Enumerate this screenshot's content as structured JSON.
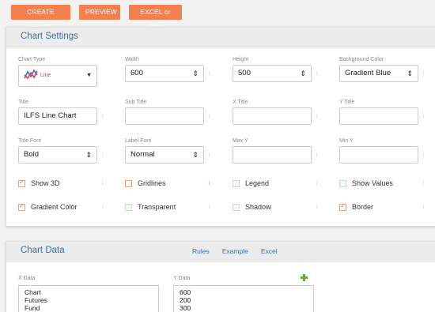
{
  "toolbar": {
    "create_chart": "CREATE CHART",
    "preview": "PREVIEW",
    "excel_csv": "EXCEL or CSV"
  },
  "settings": {
    "title": "Chart Settings",
    "chart_type": {
      "label": "Chart Type",
      "value": "Line"
    },
    "width": {
      "label": "Width",
      "value": "600"
    },
    "height": {
      "label": "Height",
      "value": "500"
    },
    "background_color": {
      "label": "Background Color",
      "value": "Gradient Blue"
    },
    "chart_title": {
      "label": "Title",
      "value": "ILFS Line Chart"
    },
    "sub_title": {
      "label": "Sub Title",
      "value": ""
    },
    "x_title": {
      "label": "X Title",
      "value": ""
    },
    "y_title": {
      "label": "Y Title",
      "value": ""
    },
    "title_font": {
      "label": "Title Font",
      "value": "Bold"
    },
    "label_font": {
      "label": "Label Font",
      "value": "Normal"
    },
    "max_y": {
      "label": "Max Y",
      "value": ""
    },
    "min_y": {
      "label": "Min Y",
      "value": ""
    },
    "checkboxes": {
      "show_3d": {
        "label": "Show 3D",
        "checked": true
      },
      "gridlines": {
        "label": "Gridlines",
        "checked": false
      },
      "legend": {
        "label": "Legend",
        "checked": false
      },
      "show_values": {
        "label": "Show Values",
        "checked": false
      },
      "gradient_color": {
        "label": "Gradient Color",
        "checked": true
      },
      "transparent": {
        "label": "Transparent",
        "checked": false
      },
      "shadow": {
        "label": "Shadow",
        "checked": false
      },
      "border": {
        "label": "Border",
        "checked": true
      }
    },
    "info_glyph": "i"
  },
  "data_panel": {
    "title": "Chart Data",
    "tabs": [
      "Rules",
      "Example",
      "Excel"
    ],
    "x_data": {
      "label": "X Data",
      "lines": [
        "Chart",
        "Futures",
        "Fund"
      ]
    },
    "y_data": {
      "label": "Y Data",
      "lines": [
        "600",
        "200",
        "300"
      ]
    }
  },
  "colors": {
    "accent": "#f47f4f",
    "heading": "#3d6fa0",
    "add": "#5cae2e"
  }
}
